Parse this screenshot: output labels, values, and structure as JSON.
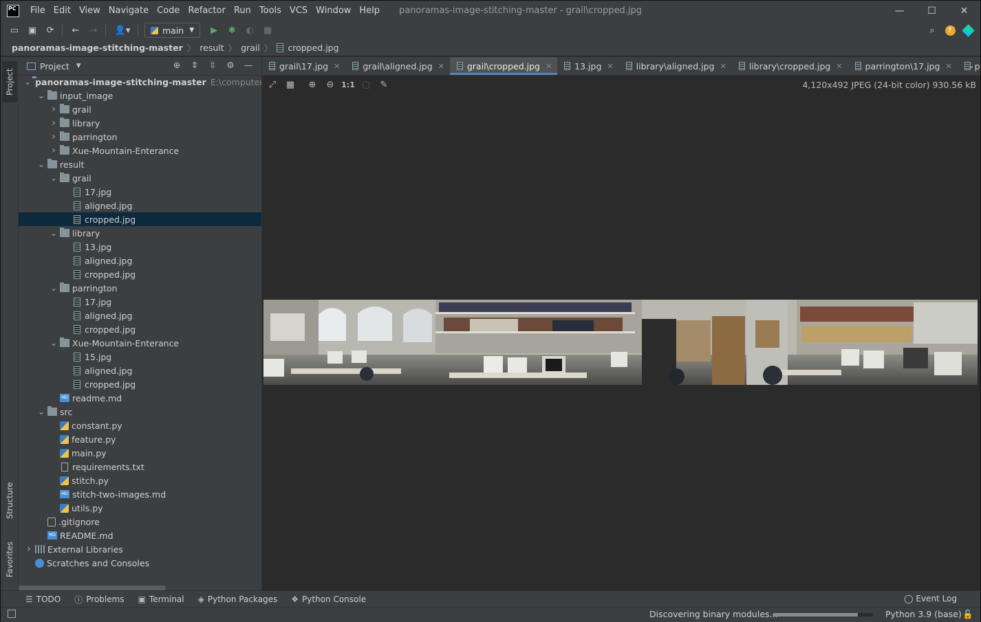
{
  "window": {
    "title": "panoramas-image-stitching-master - grail\\cropped.jpg",
    "menu": [
      "File",
      "Edit",
      "View",
      "Navigate",
      "Code",
      "Refactor",
      "Run",
      "Tools",
      "VCS",
      "Window",
      "Help"
    ],
    "controls": {
      "minimize": "—",
      "maximize": "☐",
      "close": "✕"
    },
    "logo": "PC"
  },
  "toolbar": {
    "branch": "main"
  },
  "breadcrumb": [
    "panoramas-image-stitching-master",
    "result",
    "grail",
    "cropped.jpg"
  ],
  "side_strip": {
    "project": "Project",
    "structure": "Structure",
    "favorites": "Favorites"
  },
  "project_panel": {
    "title": "Project",
    "tree": [
      {
        "label": "panoramas-image-stitching-master",
        "path": "E:\\computervisi",
        "depth": 0,
        "type": "folder",
        "open": true,
        "bold": true
      },
      {
        "label": "input_image",
        "depth": 1,
        "type": "folder",
        "open": true
      },
      {
        "label": "grail",
        "depth": 2,
        "type": "folder",
        "open": false
      },
      {
        "label": "library",
        "depth": 2,
        "type": "folder",
        "open": false
      },
      {
        "label": "parrington",
        "depth": 2,
        "type": "folder",
        "open": false
      },
      {
        "label": "Xue-Mountain-Enterance",
        "depth": 2,
        "type": "folder",
        "open": false
      },
      {
        "label": "result",
        "depth": 1,
        "type": "folder",
        "open": true
      },
      {
        "label": "grail",
        "depth": 2,
        "type": "folder",
        "open": true
      },
      {
        "label": "17.jpg",
        "depth": 3,
        "type": "file"
      },
      {
        "label": "aligned.jpg",
        "depth": 3,
        "type": "file"
      },
      {
        "label": "cropped.jpg",
        "depth": 3,
        "type": "file",
        "selected": true
      },
      {
        "label": "library",
        "depth": 2,
        "type": "folder",
        "open": true
      },
      {
        "label": "13.jpg",
        "depth": 3,
        "type": "file"
      },
      {
        "label": "aligned.jpg",
        "depth": 3,
        "type": "file"
      },
      {
        "label": "cropped.jpg",
        "depth": 3,
        "type": "file"
      },
      {
        "label": "parrington",
        "depth": 2,
        "type": "folder",
        "open": true
      },
      {
        "label": "17.jpg",
        "depth": 3,
        "type": "file"
      },
      {
        "label": "aligned.jpg",
        "depth": 3,
        "type": "file"
      },
      {
        "label": "cropped.jpg",
        "depth": 3,
        "type": "file"
      },
      {
        "label": "Xue-Mountain-Enterance",
        "depth": 2,
        "type": "folder",
        "open": true
      },
      {
        "label": "15.jpg",
        "depth": 3,
        "type": "file"
      },
      {
        "label": "aligned.jpg",
        "depth": 3,
        "type": "file"
      },
      {
        "label": "cropped.jpg",
        "depth": 3,
        "type": "file"
      },
      {
        "label": "readme.md",
        "depth": 2,
        "type": "md",
        "leaf": true
      },
      {
        "label": "src",
        "depth": 1,
        "type": "folder",
        "open": true
      },
      {
        "label": "constant.py",
        "depth": 2,
        "type": "py",
        "leaf": true
      },
      {
        "label": "feature.py",
        "depth": 2,
        "type": "py",
        "leaf": true
      },
      {
        "label": "main.py",
        "depth": 2,
        "type": "py",
        "leaf": true
      },
      {
        "label": "requirements.txt",
        "depth": 2,
        "type": "txt",
        "leaf": true
      },
      {
        "label": "stitch.py",
        "depth": 2,
        "type": "py",
        "leaf": true
      },
      {
        "label": "stitch-two-images.md",
        "depth": 2,
        "type": "md",
        "leaf": true
      },
      {
        "label": "utils.py",
        "depth": 2,
        "type": "py",
        "leaf": true
      },
      {
        "label": ".gitignore",
        "depth": 1,
        "type": "git",
        "leaf": true
      },
      {
        "label": "README.md",
        "depth": 1,
        "type": "md",
        "leaf": true
      },
      {
        "label": "External Libraries",
        "depth": 0,
        "type": "lib",
        "open": false
      },
      {
        "label": "Scratches and Consoles",
        "depth": 0,
        "type": "scr",
        "leaf": true
      }
    ]
  },
  "tabs": [
    {
      "label": "grail\\17.jpg",
      "active": false
    },
    {
      "label": "grail\\aligned.jpg",
      "active": false
    },
    {
      "label": "grail\\cropped.jpg",
      "active": true
    },
    {
      "label": "13.jpg",
      "active": false
    },
    {
      "label": "library\\aligned.jpg",
      "active": false
    },
    {
      "label": "library\\cropped.jpg",
      "active": false
    },
    {
      "label": "parrington\\17.jpg",
      "active": false
    },
    {
      "label": "p",
      "active": false
    }
  ],
  "image_viewer": {
    "zoom_actual": "1:1",
    "info": "4,120x492 JPEG (24-bit color) 930.56 kB"
  },
  "bottom_tools": [
    {
      "label": "TODO",
      "icon": "list-icon"
    },
    {
      "label": "Problems",
      "icon": "info-icon"
    },
    {
      "label": "Terminal",
      "icon": "terminal-icon"
    },
    {
      "label": "Python Packages",
      "icon": "packages-icon"
    },
    {
      "label": "Python Console",
      "icon": "python-console-icon"
    }
  ],
  "event_log": "Event Log",
  "status": {
    "message": "Discovering binary modules...",
    "progress": 0.85,
    "interpreter": "Python 3.9 (base)"
  },
  "colors": {
    "accent": "#4a88c7",
    "selection": "#0d293e",
    "panel": "#3c3f41",
    "editor": "#2b2b2b"
  }
}
